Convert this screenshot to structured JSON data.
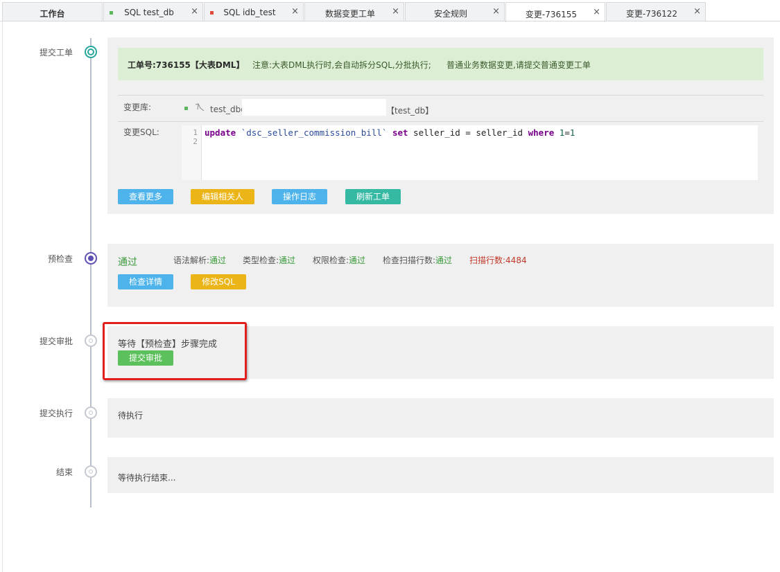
{
  "tabs": [
    {
      "label": "工作台",
      "closable": false,
      "active": false
    },
    {
      "label": "SQL test_db",
      "closable": true,
      "active": false,
      "dot_color": "#5cb85c"
    },
    {
      "label": "SQL idb_test",
      "closable": true,
      "active": false,
      "dot_color": "#e04b3c"
    },
    {
      "label": "数据变更工单",
      "closable": true,
      "active": false
    },
    {
      "label": "安全规则",
      "closable": true,
      "active": false
    },
    {
      "label": "变更-736155",
      "closable": true,
      "active": true
    },
    {
      "label": "变更-736122",
      "closable": true,
      "active": false
    }
  ],
  "close_glyph": "×",
  "steps": {
    "submit": "提交工单",
    "precheck": "预检查",
    "approval": "提交审批",
    "execute": "提交执行",
    "end": "结束"
  },
  "ticket": {
    "id_label": "工单号:736155【大表DML】",
    "notice1": "注意:大表DML执行时,会自动拆分SQL,分批执行;",
    "notice2": "普通业务数据变更,请提交普通变更工单",
    "db_label": "变更库:",
    "db_prefix": "test_db@",
    "db_suffix": "【test_db】",
    "sql_label": "变更SQL:",
    "line_numbers": [
      "1",
      "2"
    ],
    "sql": {
      "kw_update": "update",
      "table": "`dsc_seller_commission_bill`",
      "kw_set": "set",
      "assign": "seller_id = seller_id",
      "kw_where": "where",
      "num1": "1",
      "eq": "=",
      "num2": "1"
    },
    "buttons": {
      "more": "查看更多",
      "edit_related": "编辑相关人",
      "op_log": "操作日志",
      "refresh": "刷新工单"
    }
  },
  "precheck": {
    "status": "通过",
    "items": [
      {
        "label": "语法解析:",
        "value": "通过"
      },
      {
        "label": "类型检查:",
        "value": "通过"
      },
      {
        "label": "权限检查:",
        "value": "通过"
      },
      {
        "label": "检查扫描行数:",
        "value": "通过"
      }
    ],
    "scan_rows": "扫描行数:4484",
    "buttons": {
      "detail": "检查详情",
      "modify_sql": "修改SQL"
    }
  },
  "approval": {
    "message": "等待【预检查】步骤完成",
    "button": "提交审批"
  },
  "execute": {
    "message": "待执行"
  },
  "end": {
    "message": "等待执行结束..."
  },
  "colors": {
    "notice_bg": "#dcefd4",
    "pass_green": "#3a9a3a",
    "warn_red": "#c0392b",
    "highlight": "#e02020",
    "node_teal": "#26a69a",
    "node_purple": "#5e4fb3"
  }
}
